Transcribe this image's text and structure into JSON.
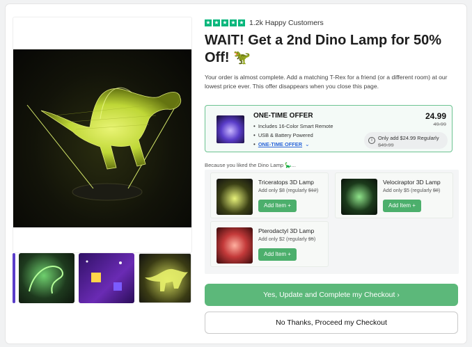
{
  "rating": {
    "stars": 5,
    "star_glyph": "★",
    "text": "1.2k Happy Customers",
    "color": "#00b67a"
  },
  "headline": "WAIT! Get a 2nd Dino Lamp for 50% Off! 🦖",
  "intro": "Your order is almost complete. Add a matching T-Rex for a friend (or a different room) at our lowest price ever. This offer disappears when you close this page.",
  "offer": {
    "title": "ONE-TIME OFFER",
    "bullets": [
      "Includes 16-Color Smart Remote",
      "USB & Battery Powered"
    ],
    "link_label": "ONE-TIME OFFER",
    "link_chevron": "⌄",
    "price": "24.99",
    "compare_price": "49.99",
    "note_prefix": "Only add $24.99 Regularly",
    "note_compare": "$49.99",
    "info_glyph": "i"
  },
  "because_label": "Because you liked the Dino Lamp 🦕...",
  "recommendations": [
    {
      "title": "Triceratops 3D Lamp",
      "sub_prefix": "Add only $8 (regularly ",
      "sub_compare": "$12",
      "sub_suffix": ")",
      "button": "Add Item +"
    },
    {
      "title": "Velociraptor 3D Lamp",
      "sub_prefix": "Add only $5 (regularly ",
      "sub_compare": "$8",
      "sub_suffix": ")",
      "button": "Add Item +"
    },
    {
      "title": "Pterodactyl 3D Lamp",
      "sub_prefix": "Add only $2 (regularly ",
      "sub_compare": "$5",
      "sub_suffix": ")",
      "button": "Add Item +"
    }
  ],
  "actions": {
    "accept": "Yes, Update and Complete my Checkout  ›",
    "decline": "No Thanks, Proceed my Checkout"
  },
  "colors": {
    "accent_green": "#5cb87a",
    "offer_border": "#6cc391",
    "link_blue": "#2b66d9"
  }
}
